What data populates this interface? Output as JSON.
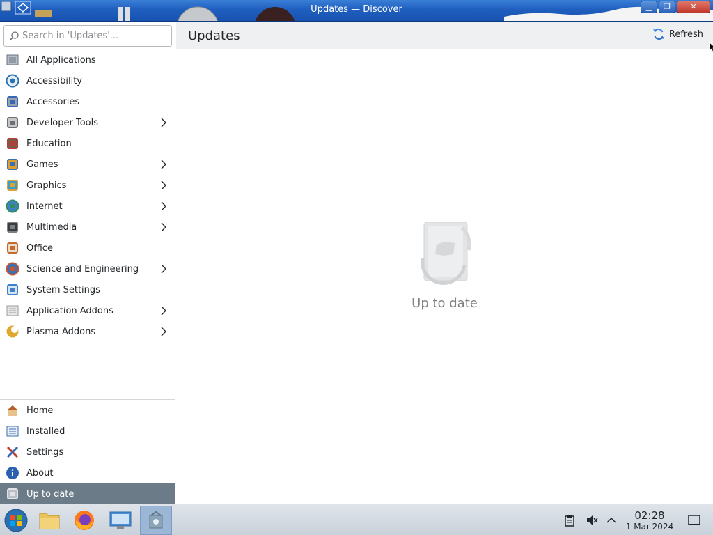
{
  "window": {
    "title": "Updates — Discover",
    "buttons": {
      "minimize": "minimize-icon",
      "maximize": "maximize-icon",
      "close": "close-icon"
    }
  },
  "search": {
    "placeholder": "Search in 'Updates'..."
  },
  "categories": [
    {
      "label": "All Applications",
      "icon": "all-applications-icon",
      "submenu": false
    },
    {
      "label": "Accessibility",
      "icon": "accessibility-icon",
      "submenu": false
    },
    {
      "label": "Accessories",
      "icon": "accessories-icon",
      "submenu": false
    },
    {
      "label": "Developer Tools",
      "icon": "developer-tools-icon",
      "submenu": true
    },
    {
      "label": "Education",
      "icon": "education-icon",
      "submenu": false
    },
    {
      "label": "Games",
      "icon": "games-icon",
      "submenu": true
    },
    {
      "label": "Graphics",
      "icon": "graphics-icon",
      "submenu": true
    },
    {
      "label": "Internet",
      "icon": "internet-icon",
      "submenu": true
    },
    {
      "label": "Multimedia",
      "icon": "multimedia-icon",
      "submenu": true
    },
    {
      "label": "Office",
      "icon": "office-icon",
      "submenu": false
    },
    {
      "label": "Science and Engineering",
      "icon": "science-icon",
      "submenu": true
    },
    {
      "label": "System Settings",
      "icon": "system-settings-icon",
      "submenu": false
    },
    {
      "label": "Application Addons",
      "icon": "application-addons-icon",
      "submenu": true
    },
    {
      "label": "Plasma Addons",
      "icon": "plasma-addons-icon",
      "submenu": true
    }
  ],
  "bottom_nav": [
    {
      "label": "Home",
      "icon": "home-icon"
    },
    {
      "label": "Installed",
      "icon": "installed-icon"
    },
    {
      "label": "Settings",
      "icon": "settings-icon"
    },
    {
      "label": "About",
      "icon": "about-icon"
    },
    {
      "label": "Up to date",
      "icon": "update-status-icon",
      "active": true
    }
  ],
  "header": {
    "title": "Updates",
    "refresh_label": "Refresh"
  },
  "main": {
    "status_text": "Up to date"
  },
  "taskbar": {
    "apps": [
      "start-menu-icon",
      "file-manager-icon",
      "firefox-icon",
      "system-settings-icon",
      "discover-icon"
    ],
    "tray": [
      "clipboard-icon",
      "volume-muted-icon",
      "tray-expand-icon",
      "show-desktop-icon"
    ],
    "time": "02:28",
    "date": "1 Mar 2024"
  },
  "colors": {
    "titlebar": "#1f5fbf",
    "active_item": "#6b7b87",
    "header_bg": "#eff0f1",
    "refresh_icon": "#3d8be8"
  }
}
